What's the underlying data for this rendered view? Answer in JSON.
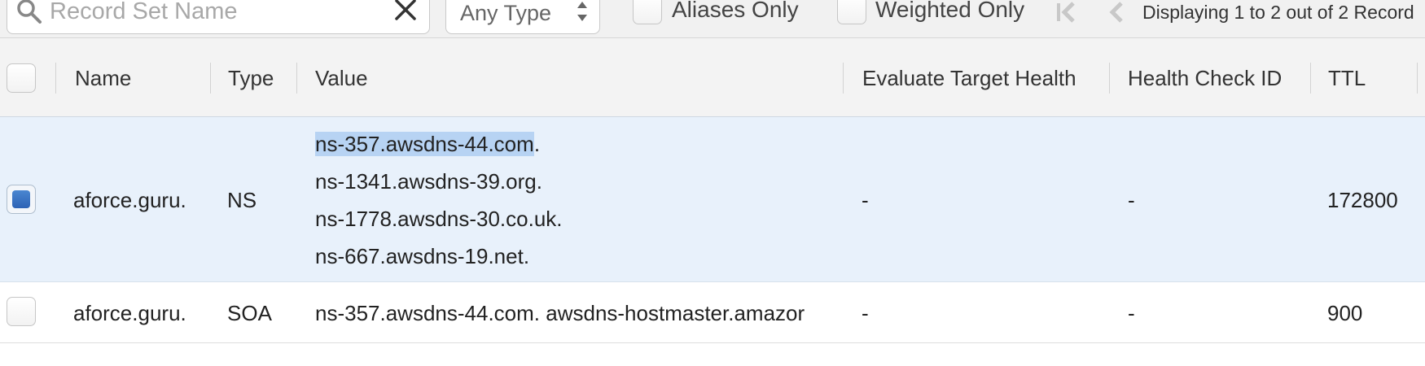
{
  "toolbar": {
    "search_placeholder": "Record Set Name",
    "type_filter": "Any Type",
    "aliases_only_label": "Aliases Only",
    "weighted_only_label": "Weighted Only",
    "pager_text": "Displaying 1 to 2 out of 2 Record"
  },
  "table": {
    "columns": [
      "Name",
      "Type",
      "Value",
      "Evaluate Target Health",
      "Health Check ID",
      "TTL"
    ],
    "rows": [
      {
        "selected": true,
        "name": "aforce.guru.",
        "type": "NS",
        "value_lines": [
          "ns-357.awsdns-44.com.",
          "ns-1341.awsdns-39.org.",
          "ns-1778.awsdns-30.co.uk.",
          "ns-667.awsdns-19.net."
        ],
        "value_highlight": "ns-357.awsdns-44.com",
        "value_highlight_rest": ".",
        "evaluate_target_health": "-",
        "health_check_id": "-",
        "ttl": "172800"
      },
      {
        "selected": false,
        "name": "aforce.guru.",
        "type": "SOA",
        "value_lines": [
          "ns-357.awsdns-44.com. awsdns-hostmaster.amazor"
        ],
        "evaluate_target_health": "-",
        "health_check_id": "-",
        "ttl": "900"
      }
    ]
  },
  "colors": {
    "selected_row_bg": "#e8f1fb",
    "checkbox_checked": "#2d63b5",
    "text_highlight": "#b7d3f3"
  },
  "icons": {
    "search": "search-icon",
    "clear": "close-icon",
    "select_arrows": "updown-arrows-icon",
    "first_page": "first-page-icon",
    "previous_page": "previous-page-icon"
  }
}
